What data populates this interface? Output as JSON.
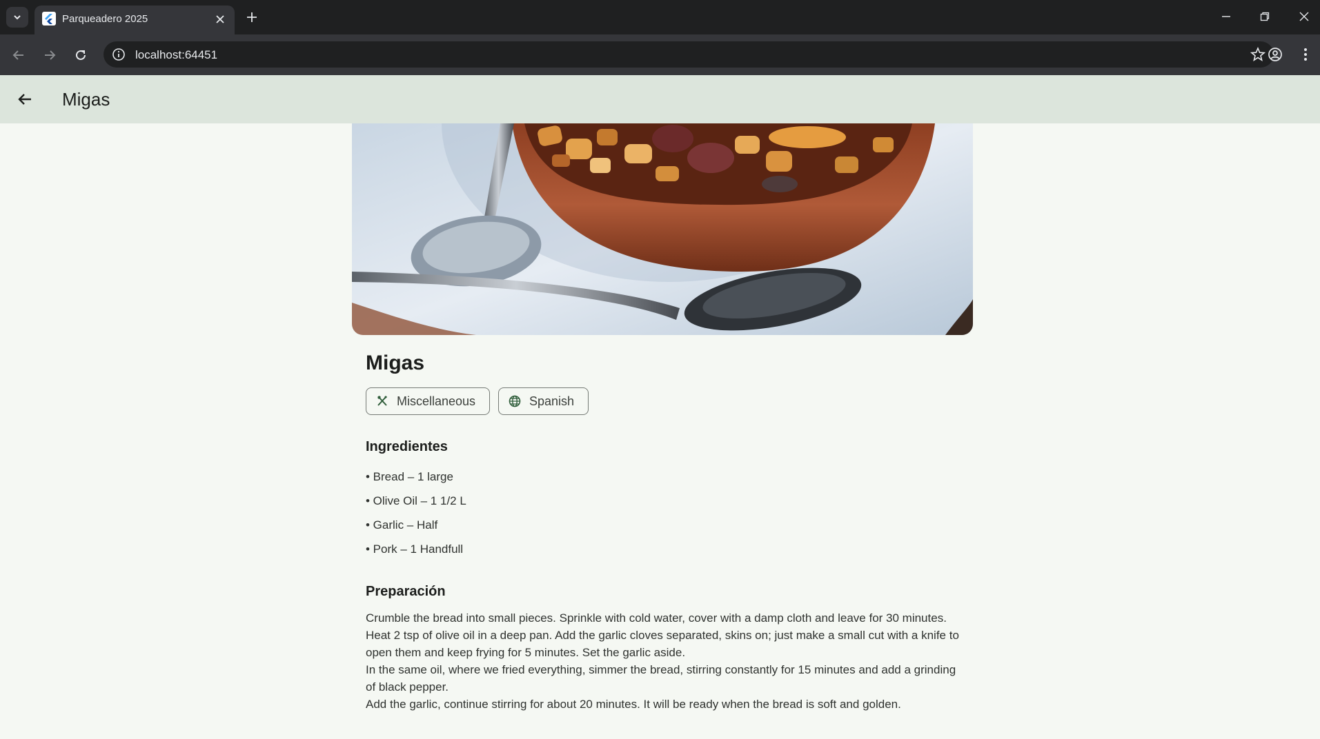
{
  "browser": {
    "tab_title": "Parqueadero 2025",
    "url": "localhost:64451"
  },
  "appbar": {
    "title": "Migas"
  },
  "recipe": {
    "title": "Migas",
    "chips": [
      {
        "label": "Miscellaneous",
        "icon": "utensils-icon"
      },
      {
        "label": "Spanish",
        "icon": "globe-icon"
      }
    ],
    "ingredients_heading": "Ingredientes",
    "ingredients": [
      "• Bread – 1 large",
      "• Olive Oil – 1 1/2 L",
      "• Garlic – Half",
      "• Pork – 1 Handfull"
    ],
    "preparation_heading": "Preparación",
    "preparation": [
      "Crumble the bread into small pieces. Sprinkle with cold water, cover with a damp cloth and leave for 30 minutes.",
      "Heat 2 tsp of olive oil in a deep pan. Add the garlic cloves separated, skins on; just make a small cut with a knife to open them and keep frying for 5 minutes. Set the garlic aside.",
      "In the same oil, where we fried everything, simmer the bread, stirring constantly for 15 minutes and add a grinding of black pepper.",
      "Add the garlic, continue stirring for about 20 minutes. It will be ready when the bread is soft and golden."
    ]
  },
  "colors": {
    "page_bg": "#f5f8f3",
    "appbar_bg": "#dce5dc",
    "chrome_dark": "#1f2021",
    "chrome_mid": "#35363a"
  }
}
